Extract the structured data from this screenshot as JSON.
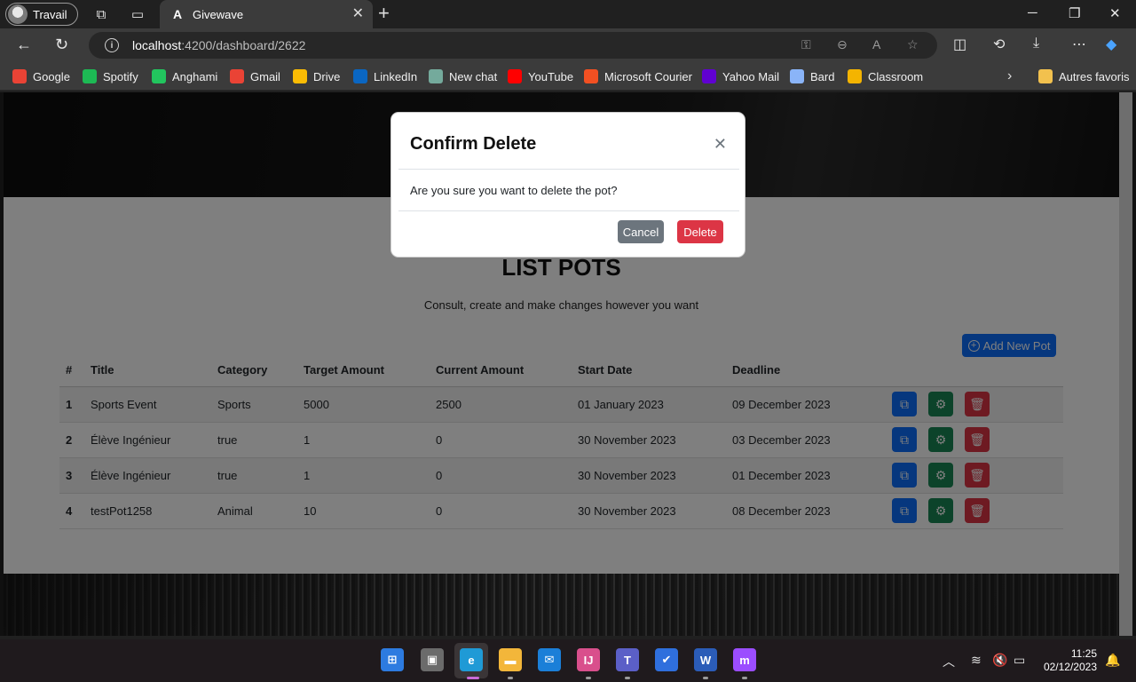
{
  "browser": {
    "profile_name": "Travail",
    "tab_title": "Givewave",
    "tab_favicon": "A",
    "url_host": "localhost",
    "url_path": ":4200/dashboard/2622",
    "bookmarks": [
      {
        "label": "Google",
        "color": "#ea4335"
      },
      {
        "label": "Spotify",
        "color": "#1db954"
      },
      {
        "label": "Anghami",
        "color": "#22c55e"
      },
      {
        "label": "Gmail",
        "color": "#ea4335"
      },
      {
        "label": "Drive",
        "color": "#fbbc04"
      },
      {
        "label": "LinkedIn",
        "color": "#0a66c2"
      },
      {
        "label": "New chat",
        "color": "#74aa9c"
      },
      {
        "label": "YouTube",
        "color": "#ff0000"
      },
      {
        "label": "Microsoft Courier",
        "color": "#f25022"
      },
      {
        "label": "Yahoo Mail",
        "color": "#6001d2"
      },
      {
        "label": "Bard",
        "color": "#8ab4f8"
      },
      {
        "label": "Classroom",
        "color": "#f4b400"
      }
    ],
    "other_favorites": "Autres favoris"
  },
  "page": {
    "title": "LIST POTS",
    "subtitle": "Consult, create and make changes however you want",
    "add_button": "Add New Pot",
    "table": {
      "headers": [
        "#",
        "Title",
        "Category",
        "Target Amount",
        "Current Amount",
        "Start Date",
        "Deadline"
      ],
      "rows": [
        {
          "num": "1",
          "title": "Sports Event",
          "category": "Sports",
          "target": "5000",
          "current": "2500",
          "start": "01 January 2023",
          "deadline": "09 December 2023"
        },
        {
          "num": "2",
          "title": "Élève Ingénieur",
          "category": "true",
          "target": "1",
          "current": "0",
          "start": "30 November 2023",
          "deadline": "03 December 2023"
        },
        {
          "num": "3",
          "title": "Élève Ingénieur",
          "category": "true",
          "target": "1",
          "current": "0",
          "start": "30 November 2023",
          "deadline": "01 December 2023"
        },
        {
          "num": "4",
          "title": "testPot1258",
          "category": "Animal",
          "target": "10",
          "current": "0",
          "start": "30 November 2023",
          "deadline": "08 December 2023"
        }
      ]
    }
  },
  "modal": {
    "title": "Confirm Delete",
    "body": "Are you sure you want to delete the pot?",
    "cancel": "Cancel",
    "delete": "Delete"
  },
  "taskbar": {
    "time": "11:25",
    "date": "02/12/2023"
  },
  "colors": {
    "primary": "#0d6efd",
    "success": "#198754",
    "danger": "#dc3545",
    "secondary": "#6c757d"
  }
}
